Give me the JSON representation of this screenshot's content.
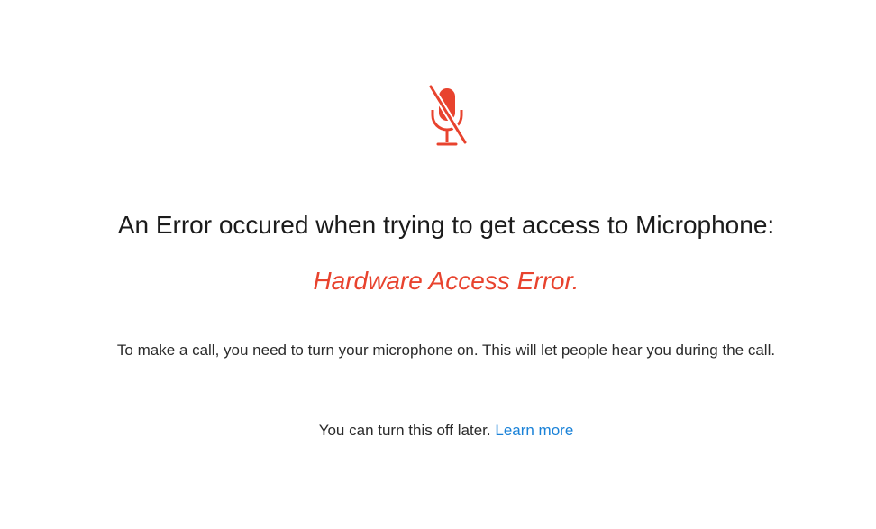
{
  "icon": {
    "name": "microphone-off-icon",
    "color": "#e8432e"
  },
  "error": {
    "title": "An Error occured when trying to get access to Microphone:",
    "name": "Hardware Access Error.",
    "name_color": "#e8432e"
  },
  "description": "To make a call, you need to turn your microphone on. This will let people hear you during the call.",
  "footnote": {
    "text": "You can turn this off later.",
    "link_label": "Learn more",
    "link_color": "#1a82d8"
  }
}
